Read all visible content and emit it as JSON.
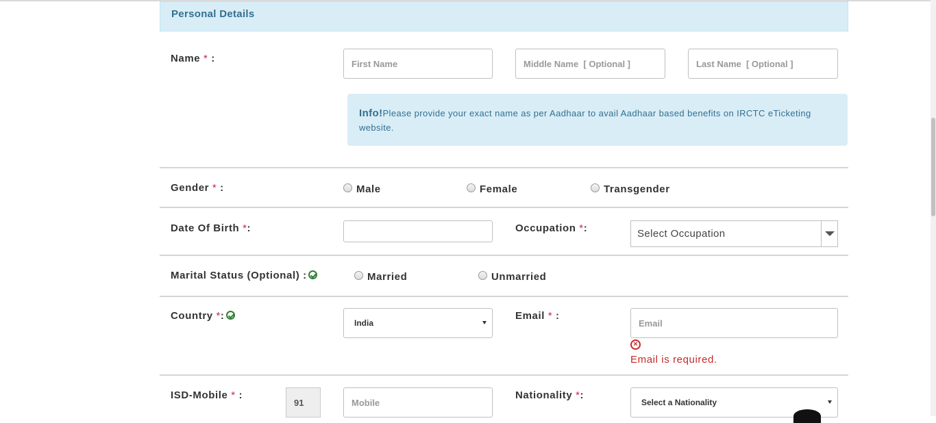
{
  "section_title": "Personal Details",
  "name": {
    "label": "Name",
    "required": "*",
    "suffix": " :",
    "first_placeholder": "First Name",
    "middle_placeholder": "Middle Name  [ Optional ]",
    "last_placeholder": "Last Name  [ Optional ]"
  },
  "info": {
    "title": "Info!",
    "text": "Please provide your exact name as per Aadhaar to avail Aadhaar based benefits on IRCTC eTicketing website."
  },
  "gender": {
    "label": "Gender",
    "required": "*",
    "suffix": " :",
    "options": [
      "Male",
      "Female",
      "Transgender"
    ]
  },
  "dob": {
    "label": "Date Of Birth",
    "required": "*",
    "suffix": ":",
    "value": ""
  },
  "occupation": {
    "label": "Occupation",
    "required": "*",
    "suffix": ":",
    "selected": "Select Occupation"
  },
  "marital": {
    "label": "Marital Status (Optional) :",
    "options": [
      "Married",
      "Unmarried"
    ]
  },
  "country": {
    "label": "Country",
    "required": "*",
    "suffix": ":",
    "selected": "India"
  },
  "email": {
    "label": "Email",
    "required": "*",
    "suffix": " :",
    "placeholder": "Email",
    "error": "Email is required."
  },
  "mobile": {
    "label": "ISD-Mobile",
    "required": "*",
    "suffix": " :",
    "isd": "91",
    "placeholder": "Mobile"
  },
  "nationality": {
    "label": "Nationality",
    "required": "*",
    "suffix": ":",
    "selected": "Select a Nationality"
  },
  "colors": {
    "header_bg": "#d9edf7",
    "header_text": "#31708f",
    "required": "#c7254e",
    "error": "#c62828",
    "valid": "#2e7d32"
  }
}
